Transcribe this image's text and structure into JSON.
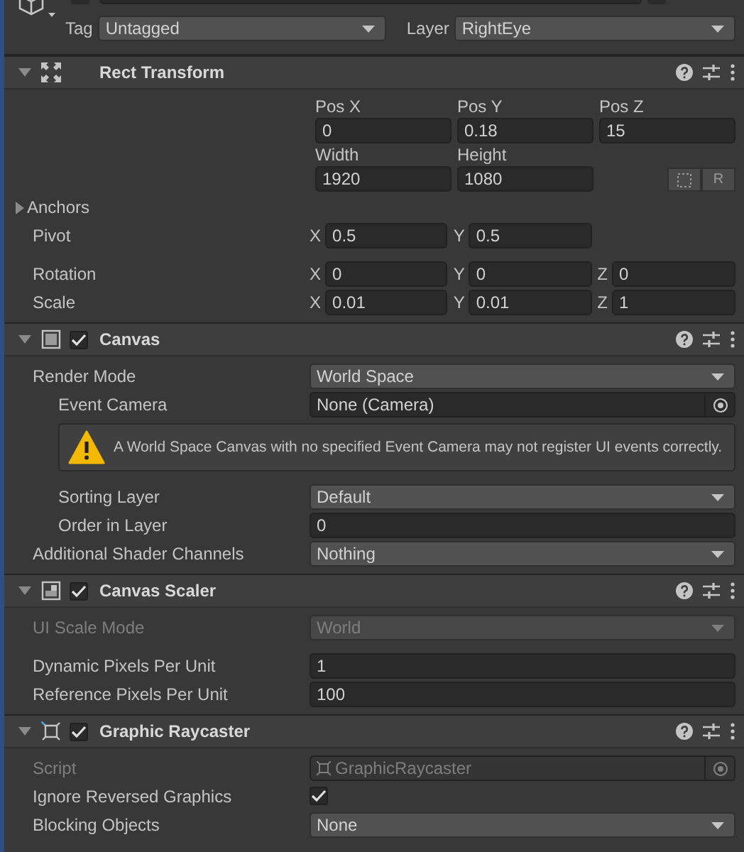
{
  "header": {
    "tag_label": "Tag",
    "tag": "Untagged",
    "layer_label": "Layer",
    "layer": "RightEye"
  },
  "components": [
    {
      "title": "Rect Transform",
      "kind": "rect",
      "expanded": true,
      "rows": [
        {
          "kind": "rect_grid",
          "position_fields": [
            {
              "label": "Pos X",
              "value": "0"
            },
            {
              "label": "Pos Y",
              "value": "0.18"
            },
            {
              "label": "Pos Z",
              "value": "15"
            }
          ],
          "size_fields": [
            {
              "label": "Width",
              "value": "1920"
            },
            {
              "label": "Height",
              "value": "1080"
            }
          ],
          "raw_label": "R"
        },
        {
          "kind": "foldout",
          "label": "Anchors",
          "expanded": false
        },
        {
          "kind": "vector",
          "label": "Pivot",
          "axes": [
            {
              "axis": "X",
              "value": "0.5"
            },
            {
              "axis": "Y",
              "value": "0.5"
            }
          ]
        },
        {
          "kind": "vector",
          "label": "Rotation",
          "gap_before": true,
          "axes": [
            {
              "axis": "X",
              "value": "0"
            },
            {
              "axis": "Y",
              "value": "0"
            },
            {
              "axis": "Z",
              "value": "0"
            }
          ]
        },
        {
          "kind": "vector",
          "label": "Scale",
          "axes": [
            {
              "axis": "X",
              "value": "0.01"
            },
            {
              "axis": "Y",
              "value": "0.01"
            },
            {
              "axis": "Z",
              "value": "1"
            }
          ]
        }
      ]
    },
    {
      "title": "Canvas",
      "kind": "canvas",
      "enabled": true,
      "expanded": true,
      "rows": [
        {
          "kind": "dropdown",
          "label": "Render Mode",
          "value": "World Space",
          "disabled": false,
          "children": [
            {
              "kind": "object",
              "label": "Event Camera",
              "value": "None (Camera)",
              "disabled": false
            },
            {
              "kind": "warning",
              "text": "A World Space Canvas with no specified Event Camera may not register UI events correctly."
            },
            {
              "kind": "dropdown",
              "label": "Sorting Layer",
              "value": "Default",
              "disabled": false,
              "gap_before": true
            },
            {
              "kind": "field",
              "label": "Order in Layer",
              "value": "0"
            }
          ]
        },
        {
          "kind": "dropdown",
          "label": "Additional Shader Channels",
          "value": "Nothing",
          "disabled": false
        }
      ]
    },
    {
      "title": "Canvas Scaler",
      "kind": "scaler",
      "enabled": true,
      "expanded": true,
      "rows": [
        {
          "kind": "dropdown",
          "label": "UI Scale Mode",
          "value": "World",
          "disabled": true
        },
        {
          "kind": "field",
          "label": "Dynamic Pixels Per Unit",
          "value": "1",
          "gap_before": true
        },
        {
          "kind": "field",
          "label": "Reference Pixels Per Unit",
          "value": "100"
        }
      ]
    },
    {
      "title": "Graphic Raycaster",
      "kind": "raycaster",
      "enabled": true,
      "expanded": true,
      "rows": [
        {
          "kind": "script",
          "label": "Script",
          "value": "GraphicRaycaster",
          "disabled": true
        },
        {
          "kind": "toggle",
          "label": "Ignore Reversed Graphics",
          "checked": true
        },
        {
          "kind": "dropdown",
          "label": "Blocking Objects",
          "value": "None",
          "disabled": false
        }
      ]
    }
  ]
}
